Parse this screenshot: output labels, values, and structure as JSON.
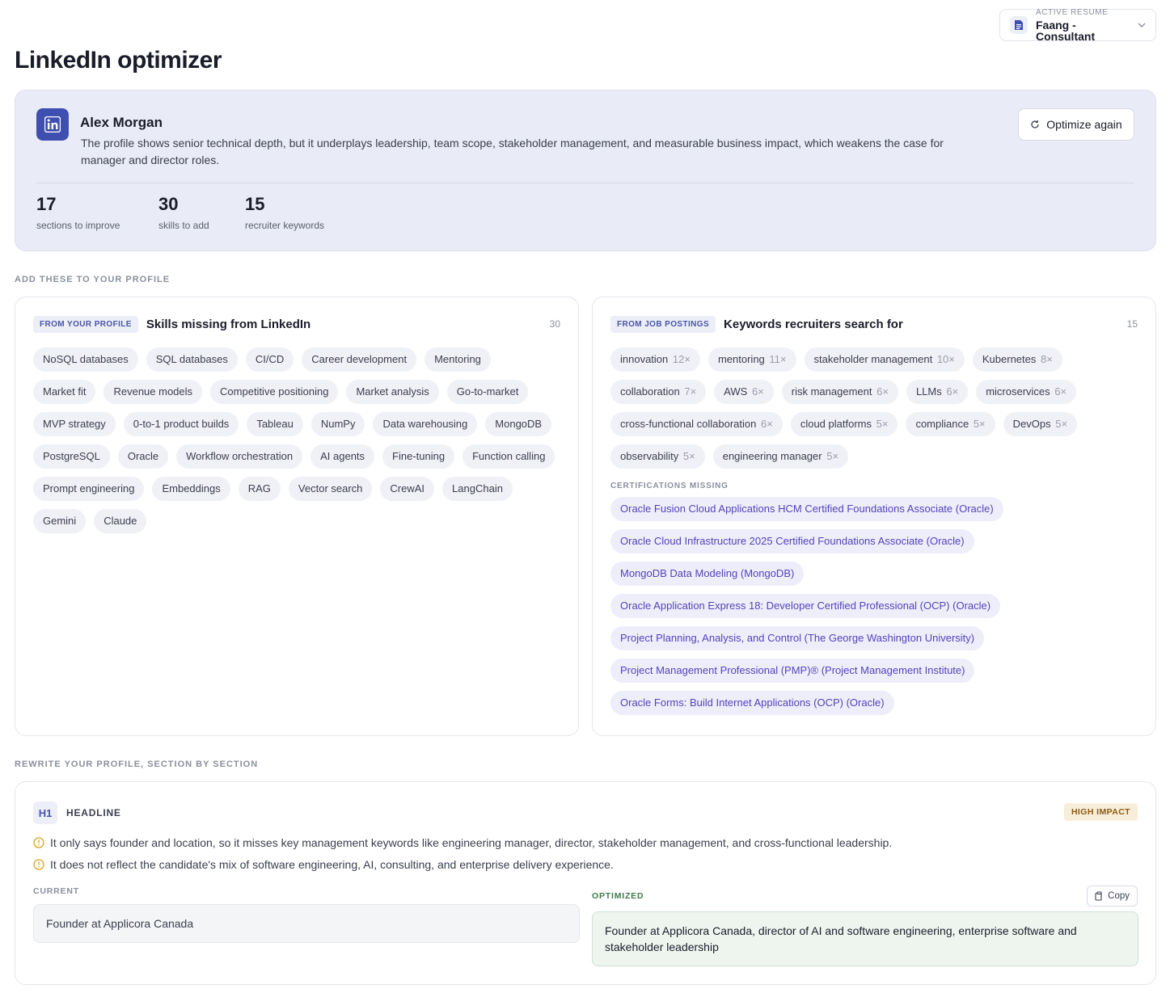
{
  "active_resume": {
    "label": "ACTIVE RESUME",
    "value": "Faang - Consultant"
  },
  "page_title": "LinkedIn optimizer",
  "profile": {
    "name": "Alex Morgan",
    "summary": "The profile shows senior technical depth, but it underplays leadership, team scope, stakeholder management, and measurable business impact, which weakens the case for manager and director roles.",
    "optimize_label": "Optimize again",
    "stats": [
      {
        "value": "17",
        "caption": "sections to improve"
      },
      {
        "value": "30",
        "caption": "skills to add"
      },
      {
        "value": "15",
        "caption": "recruiter keywords"
      }
    ]
  },
  "add_section_label": "ADD THESE TO YOUR PROFILE",
  "skills_panel": {
    "tag": "FROM YOUR PROFILE",
    "title": "Skills missing from LinkedIn",
    "count": "30",
    "skills": [
      "NoSQL databases",
      "SQL databases",
      "CI/CD",
      "Career development",
      "Mentoring",
      "Market fit",
      "Revenue models",
      "Competitive positioning",
      "Market analysis",
      "Go-to-market",
      "MVP strategy",
      "0-to-1 product builds",
      "Tableau",
      "NumPy",
      "Data warehousing",
      "MongoDB",
      "PostgreSQL",
      "Oracle",
      "Workflow orchestration",
      "AI agents",
      "Fine-tuning",
      "Function calling",
      "Prompt engineering",
      "Embeddings",
      "RAG",
      "Vector search",
      "CrewAI",
      "LangChain",
      "Gemini",
      "Claude"
    ]
  },
  "keywords_panel": {
    "tag": "FROM JOB POSTINGS",
    "title": "Keywords recruiters search for",
    "count": "15",
    "keywords": [
      {
        "text": "innovation",
        "mult": "12×"
      },
      {
        "text": "mentoring",
        "mult": "11×"
      },
      {
        "text": "stakeholder management",
        "mult": "10×"
      },
      {
        "text": "Kubernetes",
        "mult": "8×"
      },
      {
        "text": "collaboration",
        "mult": "7×"
      },
      {
        "text": "AWS",
        "mult": "6×"
      },
      {
        "text": "risk management",
        "mult": "6×"
      },
      {
        "text": "LLMs",
        "mult": "6×"
      },
      {
        "text": "microservices",
        "mult": "6×"
      },
      {
        "text": "cross-functional collaboration",
        "mult": "6×"
      },
      {
        "text": "cloud platforms",
        "mult": "5×"
      },
      {
        "text": "compliance",
        "mult": "5×"
      },
      {
        "text": "DevOps",
        "mult": "5×"
      },
      {
        "text": "observability",
        "mult": "5×"
      },
      {
        "text": "engineering manager",
        "mult": "5×"
      }
    ],
    "cert_label": "CERTIFICATIONS MISSING",
    "certifications": [
      "Oracle Fusion Cloud Applications HCM Certified Foundations Associate (Oracle)",
      "Oracle Cloud Infrastructure 2025 Certified Foundations Associate (Oracle)",
      "MongoDB Data Modeling (MongoDB)",
      "Oracle Application Express 18: Developer Certified Professional (OCP) (Oracle)",
      "Project Planning, Analysis, and Control (The George Washington University)",
      "Project Management Professional (PMP)® (Project Management Institute)",
      "Oracle Forms: Build Internet Applications (OCP) (Oracle)"
    ]
  },
  "rewrite_section_label": "REWRITE YOUR PROFILE, SECTION BY SECTION",
  "headline_section": {
    "badge": "H1",
    "name": "HEADLINE",
    "impact": "HIGH IMPACT",
    "issues": [
      "It only says founder and location, so it misses key management keywords like engineering manager, director, stakeholder management, and cross-functional leadership.",
      "It does not reflect the candidate's mix of software engineering, AI, consulting, and enterprise delivery experience."
    ],
    "current_label": "CURRENT",
    "current_value": "Founder at Applicora Canada",
    "optimized_label": "OPTIMIZED",
    "optimized_value": "Founder at Applicora Canada, director of AI and software engineering, enterprise software and stakeholder leadership",
    "copy_label": "Copy"
  },
  "colors": {
    "accent": "#3f4fb0",
    "card_bg": "#e9ebf6",
    "cert_text": "#5243b8",
    "impact_bg": "#f8edd8",
    "optimized_label": "#3f7a4a",
    "warn": "#d9a420"
  }
}
